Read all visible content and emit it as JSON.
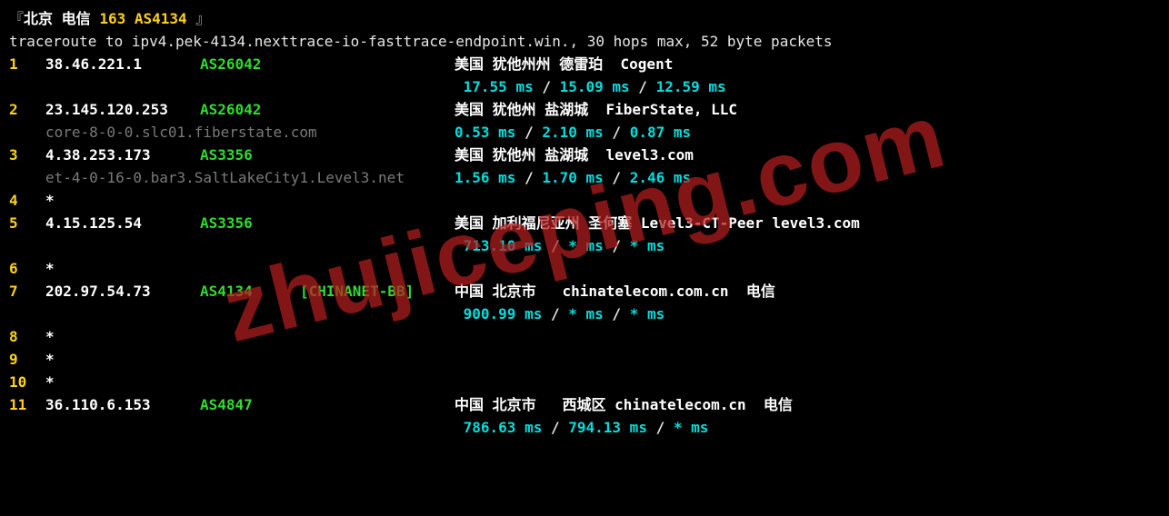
{
  "header": {
    "location": "北京",
    "isp": "电信",
    "asntag": "163 AS4134"
  },
  "cmd": "traceroute to ipv4.pek-4134.nexttrace-io-fasttrace-endpoint.win., 30 hops max, 52 byte packets",
  "watermark": "zhujiceping.com",
  "hops": [
    {
      "n": "1",
      "ip": "38.46.221.1",
      "asn": "AS26042",
      "tag": "",
      "loc": "美国 犹他州州 德雷珀  Cogent",
      "host": "",
      "rtts": [
        "17.55 ms",
        "15.09 ms",
        "12.59 ms"
      ]
    },
    {
      "n": "2",
      "ip": "23.145.120.253",
      "asn": "AS26042",
      "tag": "",
      "loc": "美国 犹他州 盐湖城  FiberState, LLC",
      "host": "core-8-0-0.slc01.fiberstate.com",
      "rtts": [
        "0.53 ms",
        "2.10 ms",
        "0.87 ms"
      ]
    },
    {
      "n": "3",
      "ip": "4.38.253.173",
      "asn": "AS3356",
      "tag": "",
      "loc": "美国 犹他州 盐湖城  level3.com",
      "host": "et-4-0-16-0.bar3.SaltLakeCity1.Level3.net",
      "rtts": [
        "1.56 ms",
        "1.70 ms",
        "2.46 ms"
      ]
    },
    {
      "n": "4",
      "ip": "*",
      "asn": "",
      "tag": "",
      "loc": "",
      "host": "",
      "rtts": []
    },
    {
      "n": "5",
      "ip": "4.15.125.54",
      "asn": "AS3356",
      "tag": "",
      "loc": "美国 加利福尼亚州 圣何塞 Level3-CT-Peer level3.com",
      "host": "",
      "rtts": [
        "713.10 ms",
        "* ms",
        "* ms"
      ]
    },
    {
      "n": "6",
      "ip": "*",
      "asn": "",
      "tag": "",
      "loc": "",
      "host": "",
      "rtts": []
    },
    {
      "n": "7",
      "ip": "202.97.54.73",
      "asn": "AS4134",
      "tag": "[CHINANET-BB]",
      "loc": "中国 北京市   chinatelecom.com.cn  电信",
      "host": "",
      "rtts": [
        "900.99 ms",
        "* ms",
        "* ms"
      ]
    },
    {
      "n": "8",
      "ip": "*",
      "asn": "",
      "tag": "",
      "loc": "",
      "host": "",
      "rtts": []
    },
    {
      "n": "9",
      "ip": "*",
      "asn": "",
      "tag": "",
      "loc": "",
      "host": "",
      "rtts": []
    },
    {
      "n": "10",
      "ip": "*",
      "asn": "",
      "tag": "",
      "loc": "",
      "host": "",
      "rtts": []
    },
    {
      "n": "11",
      "ip": "36.110.6.153",
      "asn": "AS4847",
      "tag": "",
      "loc": "中国 北京市   西城区 chinatelecom.cn  电信",
      "host": "",
      "rtts": [
        "786.63 ms",
        "794.13 ms",
        "* ms"
      ]
    }
  ]
}
